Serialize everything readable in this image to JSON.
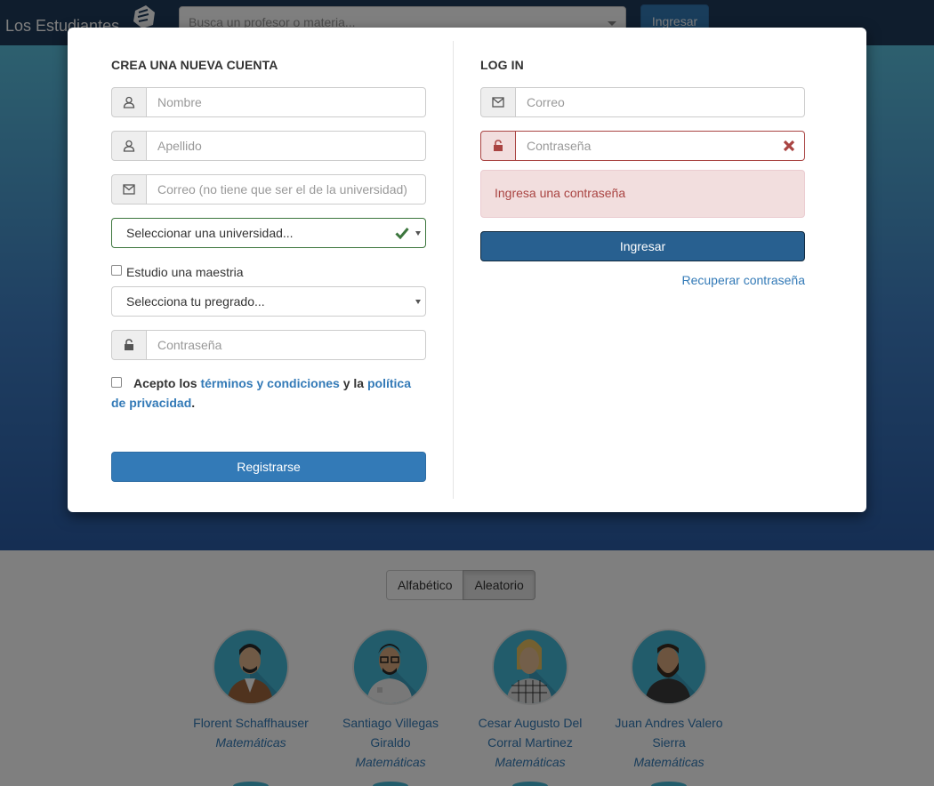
{
  "navbar": {
    "brand": "Los Estudiantes",
    "search_placeholder": "Busca un profesor o materia...",
    "login_button": "Ingresar"
  },
  "sort": {
    "options": [
      "Alfabético",
      "Aleatorio"
    ],
    "active": "Aleatorio"
  },
  "professors": [
    {
      "name": "Florent Schaffhauser",
      "subject": "Matemáticas"
    },
    {
      "name": "Santiago Villegas Giraldo",
      "subject": "Matemáticas"
    },
    {
      "name": "Cesar Augusto Del Corral Martinez",
      "subject": "Matemáticas"
    },
    {
      "name": "Juan Andres Valero Sierra",
      "subject": "Matemáticas"
    }
  ],
  "register": {
    "title": "CREA UNA NUEVA CUENTA",
    "nombre_placeholder": "Nombre",
    "apellido_placeholder": "Apellido",
    "correo_placeholder": "Correo (no tiene que ser el de la universidad)",
    "universidad_select": "Seleccionar una universidad...",
    "maestria_label": "Estudio una maestria",
    "pregrado_select": "Selecciona tu pregrado...",
    "password_placeholder": "Contraseña",
    "terms_prefix": "Acepto los",
    "terms_link": "términos y condiciones",
    "terms_middle": "y la",
    "privacy_link": "política de privacidad",
    "terms_suffix": ".",
    "submit": "Registrarse"
  },
  "login": {
    "title": "LOG IN",
    "correo_placeholder": "Correo",
    "password_placeholder": "Contraseña",
    "error_message": "Ingresa una contraseña",
    "submit": "Ingresar",
    "forgot_link": "Recuperar contraseña"
  },
  "colors": {
    "primary": "#337ab7",
    "error": "#a94442",
    "error_bg": "#f2dede",
    "success": "#3c763d",
    "navbar": "#1f3a5a"
  },
  "icons": {
    "user": "user-icon",
    "mail": "envelope-icon",
    "lock": "lock-icon",
    "error": "times-icon",
    "ok": "check-icon",
    "logo": "fist-icon"
  }
}
